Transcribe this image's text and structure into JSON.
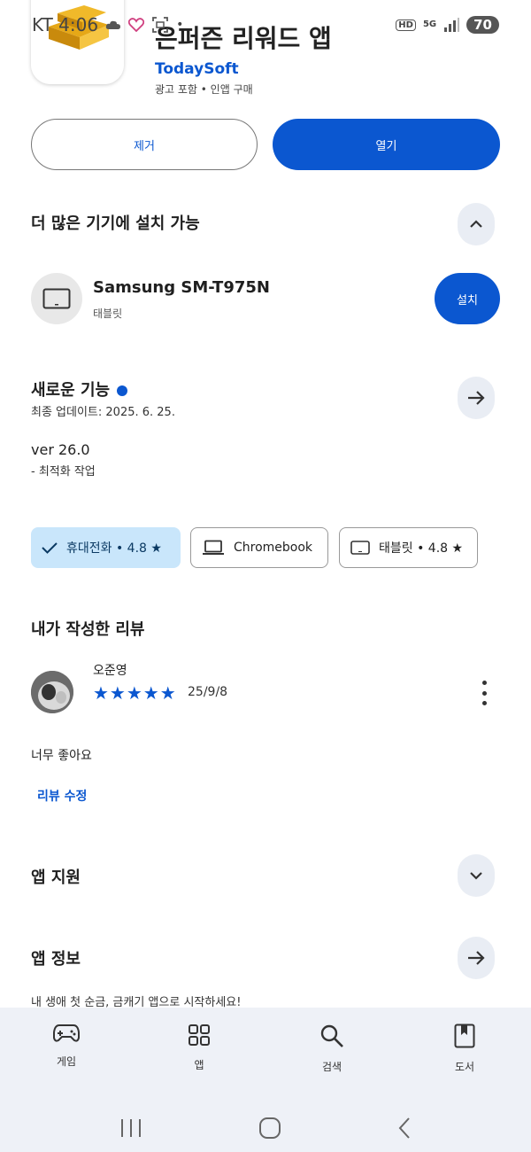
{
  "status_bar": {
    "carrier_time": "KT 4:06",
    "hd": "HD",
    "network": "5G",
    "battery": "70"
  },
  "app": {
    "name": "은퍼즌 리워드 앱",
    "developer": "TodaySoft",
    "meta": "광고 포함 • 인앱 구매"
  },
  "actions": {
    "uninstall_label": "제거",
    "open_label": "열기"
  },
  "devices_section": {
    "title": "더 많은 기기에 설치 가능",
    "device_name": "Samsung SM-T975N",
    "device_type": "태블릿",
    "install_label": "설치"
  },
  "whats_new": {
    "title": "새로운 기능",
    "updated": "최종 업데이트: 2025. 6. 25.",
    "version": "ver 26.0",
    "notes": "- 최적화 작업"
  },
  "device_chips": [
    {
      "label": "휴대전화 • 4.8 ★",
      "selected": true
    },
    {
      "label": "Chromebook",
      "selected": false
    },
    {
      "label": "태블릿 • 4.8 ★",
      "selected": false
    }
  ],
  "my_review": {
    "title": "내가 작성한 리뷰",
    "reviewer": "오준영",
    "stars": "★★★★★",
    "rating": 5,
    "date": "25/9/8",
    "text": "너무 좋아요",
    "edit_label": "리뷰 수정"
  },
  "app_support": {
    "title": "앱 지원"
  },
  "app_info": {
    "title": "앱 정보",
    "description": "내 생애 첫 순금, 금캐기 앱으로 시작하세요!"
  },
  "bottom_nav": [
    {
      "label": "게임",
      "icon": "gamepad-icon"
    },
    {
      "label": "앱",
      "icon": "apps-grid-icon"
    },
    {
      "label": "검색",
      "icon": "search-icon"
    },
    {
      "label": "도서",
      "icon": "book-icon"
    }
  ],
  "colors": {
    "primary": "#0b57d0",
    "chip_selected": "#c9e6fb",
    "round_button": "#e9edf4",
    "nav_background": "#eef1f7"
  }
}
